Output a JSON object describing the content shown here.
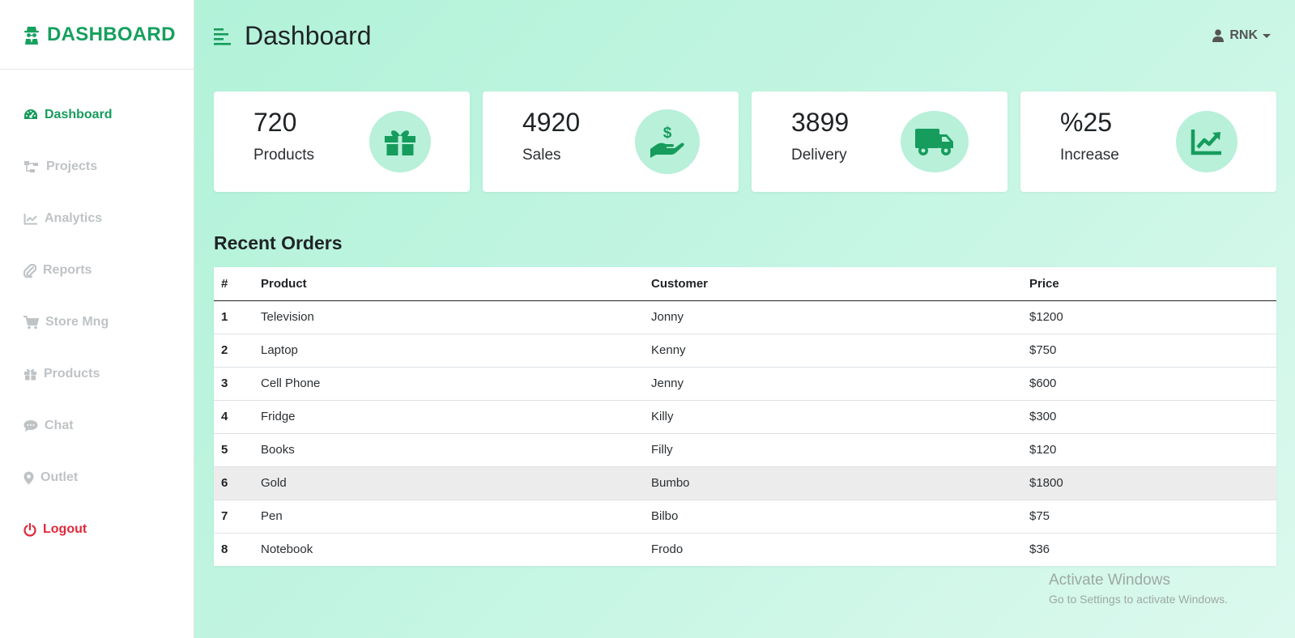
{
  "brand": {
    "title": "DASHBOARD",
    "color": "#16a05e"
  },
  "sidebar": {
    "items": [
      {
        "label": "Dashboard",
        "icon": "gauge-icon",
        "active": true
      },
      {
        "label": "Projects",
        "icon": "sitemap-icon"
      },
      {
        "label": "Analytics",
        "icon": "chart-line-icon"
      },
      {
        "label": "Reports",
        "icon": "paperclip-icon"
      },
      {
        "label": "Store Mng",
        "icon": "cart-icon"
      },
      {
        "label": "Products",
        "icon": "gift-icon"
      },
      {
        "label": "Chat",
        "icon": "chat-bubble-icon"
      },
      {
        "label": "Outlet",
        "icon": "map-pin-icon"
      },
      {
        "label": "Logout",
        "icon": "power-icon",
        "danger": true
      }
    ]
  },
  "header": {
    "title": "Dashboard",
    "user": "RNK"
  },
  "cards": [
    {
      "value": "720",
      "label": "Products",
      "icon": "gift-icon"
    },
    {
      "value": "4920",
      "label": "Sales",
      "icon": "hand-dollar-icon"
    },
    {
      "value": "3899",
      "label": "Delivery",
      "icon": "truck-icon"
    },
    {
      "value": "%25",
      "label": "Increase",
      "icon": "chart-up-icon"
    }
  ],
  "orders": {
    "title": "Recent Orders",
    "columns": [
      "#",
      "Product",
      "Customer",
      "Price"
    ],
    "rows": [
      [
        "1",
        "Television",
        "Jonny",
        "$1200"
      ],
      [
        "2",
        "Laptop",
        "Kenny",
        "$750"
      ],
      [
        "3",
        "Cell Phone",
        "Jenny",
        "$600"
      ],
      [
        "4",
        "Fridge",
        "Killy",
        "$300"
      ],
      [
        "5",
        "Books",
        "Filly",
        "$120"
      ],
      [
        "6",
        "Gold",
        "Bumbo",
        "$1800"
      ],
      [
        "7",
        "Pen",
        "Bilbo",
        "$75"
      ],
      [
        "8",
        "Notebook",
        "Frodo",
        "$36"
      ]
    ]
  },
  "watermark": {
    "title": "Activate Windows",
    "subtitle": "Go to Settings to activate Windows."
  },
  "colors": {
    "accent": "#169c5c",
    "icon_bg": "#b8f0da",
    "logout": "#e0283a",
    "inactive": "#bfc3c6"
  }
}
